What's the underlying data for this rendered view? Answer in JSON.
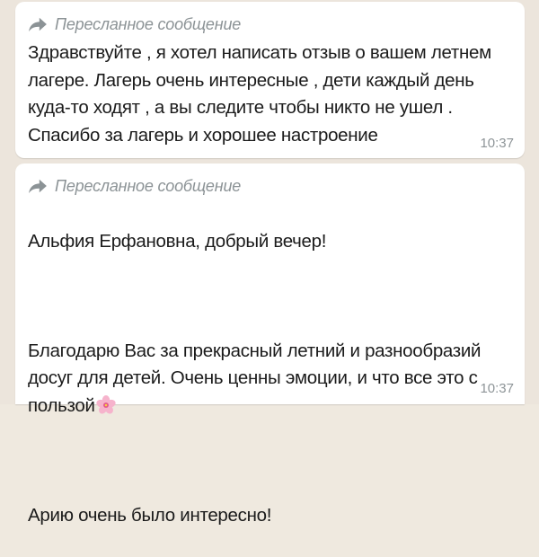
{
  "messages": [
    {
      "forwarded_label": "Пересланное сообщение",
      "text": "Здравствуйте , я хотел написать отзыв о вашем летнем\nлагере. Лагерь очень интересные , дети каждый день\nкуда-то ходят , а вы следите чтобы никто не ушел .\nСпасибо за лагерь и хорошее настроение",
      "time": "10:37"
    },
    {
      "forwarded_label": "Пересланное сообщение",
      "line_1": "Альфия Ерфановна, добрый вечер!",
      "line_2": "Благодарю Вас за прекрасный летний и разнообразий\nдосуг для детей. Очень ценны эмоции, и что все это с\nпользой",
      "emoji": "cherry-blossom-icon",
      "line_3": "Арию очень было интересно!",
      "time": "10:37"
    }
  ],
  "colors": {
    "chat_background": "#ece5dc",
    "bubble_background": "#ffffff",
    "meta_text": "#8c9396",
    "message_text": "#1b1b1b"
  }
}
